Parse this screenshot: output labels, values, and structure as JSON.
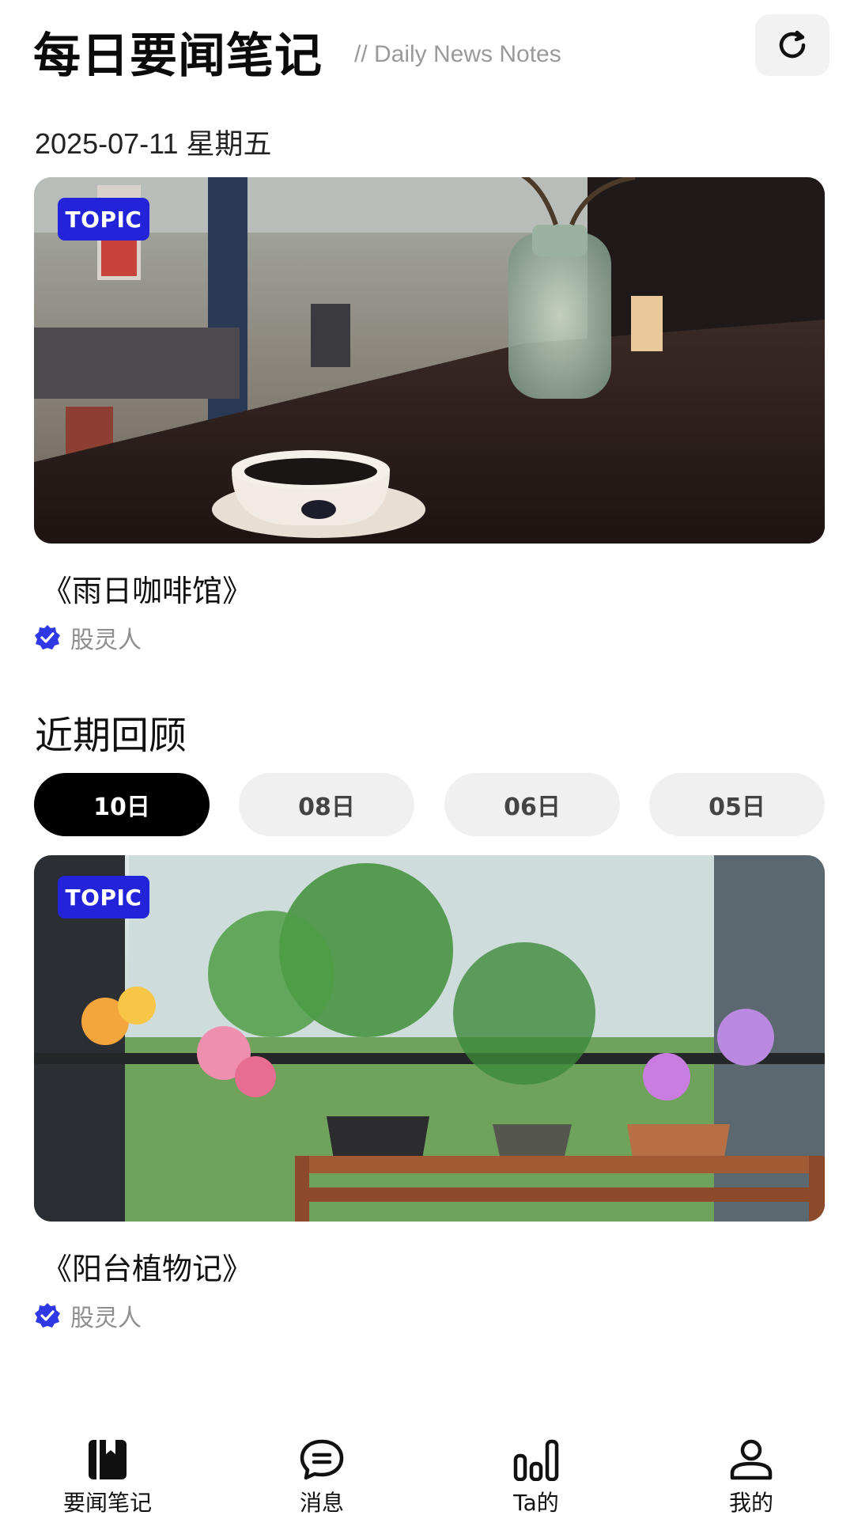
{
  "header": {
    "title": "每日要闻笔记",
    "subtitle": "// Daily News Notes",
    "refresh_icon": "refresh-icon"
  },
  "date_line": "2025-07-11 星期五",
  "featured": {
    "badge": "TOPIC",
    "title": "《雨日咖啡馆》",
    "author": "股灵人",
    "image_icon": "cafe-photo"
  },
  "recent": {
    "section_title": "近期回顾",
    "pills": [
      {
        "label": "10日",
        "active": true
      },
      {
        "label": "08日",
        "active": false
      },
      {
        "label": "06日",
        "active": false
      },
      {
        "label": "05日",
        "active": false
      }
    ],
    "card": {
      "badge": "TOPIC",
      "title": "《阳台植物记》",
      "author": "股灵人",
      "image_icon": "balcony-plants-photo"
    }
  },
  "tabbar": {
    "items": [
      {
        "label": "要闻笔记",
        "icon": "bookmark-book-icon"
      },
      {
        "label": "消息",
        "icon": "chat-bubble-icon"
      },
      {
        "label": "Ta的",
        "icon": "bar-chart-icon"
      },
      {
        "label": "我的",
        "icon": "user-icon"
      }
    ]
  },
  "colors": {
    "accent": "#2323d9",
    "pill_active_bg": "#000000",
    "pill_bg": "#f0f0f0",
    "muted_text": "#8e8e8e"
  }
}
